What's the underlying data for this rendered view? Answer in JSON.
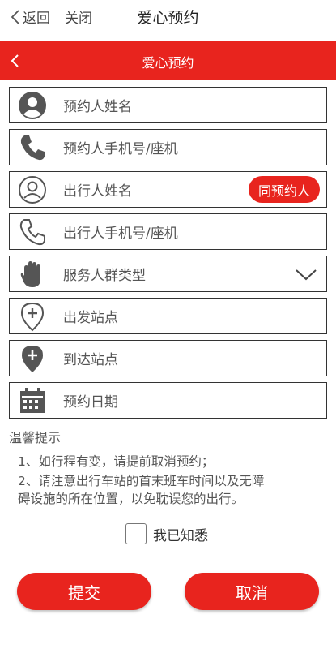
{
  "topbar": {
    "back_label": "返回",
    "close_label": "关闭",
    "title": "爱心预约"
  },
  "header": {
    "title": "爱心预约"
  },
  "form": {
    "booker_name_placeholder": "预约人姓名",
    "booker_phone_placeholder": "预约人手机号/座机",
    "traveler_name_placeholder": "出行人姓名",
    "same_as_booker_label": "同预约人",
    "traveler_phone_placeholder": "出行人手机号/座机",
    "service_group_placeholder": "服务人群类型",
    "departure_station_placeholder": "出发站点",
    "arrival_station_placeholder": "到达站点",
    "date_placeholder": "预约日期"
  },
  "tips": {
    "title": "温馨提示",
    "line1": "1、如行程有变，请提前取消预约；",
    "line2a": "2、请注意出行车站的首末班车时间以及无障",
    "line2b": "碍设施的所在位置，以免耽误您的出行。"
  },
  "agree": {
    "label": "我已知悉",
    "checked": false
  },
  "actions": {
    "submit_label": "提交",
    "cancel_label": "取消"
  },
  "colors": {
    "accent": "#e8241e"
  }
}
